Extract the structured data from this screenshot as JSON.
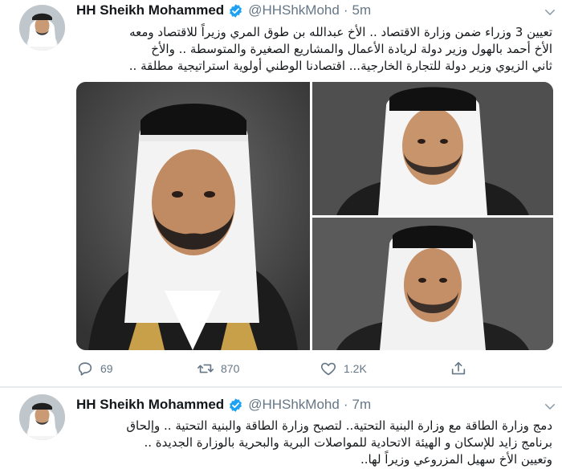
{
  "colors": {
    "accent": "#1da1f2",
    "text_primary": "#14171a",
    "text_secondary": "#657786",
    "divider": "#e6ecf0"
  },
  "tweets": [
    {
      "author": {
        "name": "HH Sheikh Mohammed",
        "handle": "@HHShkMohd",
        "verified": true,
        "avatar_icon": "avatar-portrait-icon"
      },
      "separator": "·",
      "time": "5m",
      "text_lines": [
        "تعيين 3 وزراء ضمن وزارة الاقتصاد .. الأخ عبدالله بن طوق المري وزيراً للاقتصاد ومعه",
        "الأخ أحمد بالهول وزير دولة لريادة الأعمال والمشاريع الصغيرة والمتوسطة .. والأخ",
        "ثاني الزيوي وزير دولة للتجارة الخارجية... اقتصادنا الوطني أولوية استراتيجية مطلقة .."
      ],
      "media": [
        "portrait-photo-large",
        "portrait-photo-top-right",
        "portrait-photo-bottom-right"
      ],
      "actions": {
        "reply": {
          "icon": "reply-icon",
          "count": "69"
        },
        "retweet": {
          "icon": "retweet-icon",
          "count": "870"
        },
        "like": {
          "icon": "heart-icon",
          "count": "1.2K"
        },
        "share": {
          "icon": "share-icon"
        }
      }
    },
    {
      "author": {
        "name": "HH Sheikh Mohammed",
        "handle": "@HHShkMohd",
        "verified": true,
        "avatar_icon": "avatar-portrait-icon"
      },
      "separator": "·",
      "time": "7m",
      "text_lines": [
        "دمج وزارة الطاقة مع وزارة البنية التحتية.. لتصبح وزارة الطاقة والبنية التحتية .. وإلحاق",
        "برنامج زايد للإسكان و الهيئة الاتحادية للمواصلات البرية والبحرية بالوزارة الجديدة ..",
        "وتعيين الأخ سهيل المزروعي وزيراً لها.."
      ]
    }
  ]
}
